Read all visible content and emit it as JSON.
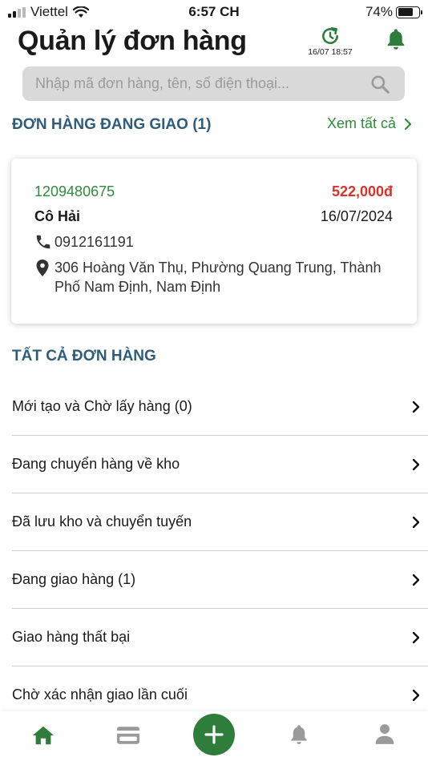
{
  "status_bar": {
    "carrier": "Viettel",
    "time": "6:57 CH",
    "battery": "74%"
  },
  "header": {
    "title": "Quản lý đơn hàng",
    "sync_time": "16/07 18:57",
    "icons": [
      "sync-clock-icon",
      "bell-icon"
    ]
  },
  "search": {
    "placeholder": "Nhập mã đơn hàng, tên, số điện thoại..."
  },
  "in_delivery": {
    "title": "ĐƠN HÀNG ĐANG GIAO  (1)",
    "see_all": "Xem tất cả",
    "order": {
      "id": "1209480675",
      "price": "522,000đ",
      "customer": "Cô Hải",
      "date": "16/07/2024",
      "phone": "0912161191",
      "address": "306 Hoàng Văn Thụ, Phường Quang Trung, Thành Phố Nam Định, Nam Định"
    }
  },
  "all_orders": {
    "title": "TẤT CẢ ĐƠN HÀNG",
    "items": [
      {
        "label": "Mới tạo và Chờ lấy hàng (0)"
      },
      {
        "label": "Đang chuyển hàng về kho"
      },
      {
        "label": "Đã lưu kho và chuyển tuyến"
      },
      {
        "label": "Đang giao hàng (1)"
      },
      {
        "label": "Giao hàng thất bại"
      },
      {
        "label": "Chờ xác nhận giao lần cuối"
      }
    ]
  },
  "tabbar": {
    "icons": [
      "home-icon",
      "card-icon",
      "add-icon",
      "bell-icon",
      "profile-icon"
    ]
  },
  "colors": {
    "accent_green": "#2e7d3a",
    "link_green": "#2e8b3a",
    "price_red": "#d9332b",
    "section_blue": "#2f5d79"
  }
}
